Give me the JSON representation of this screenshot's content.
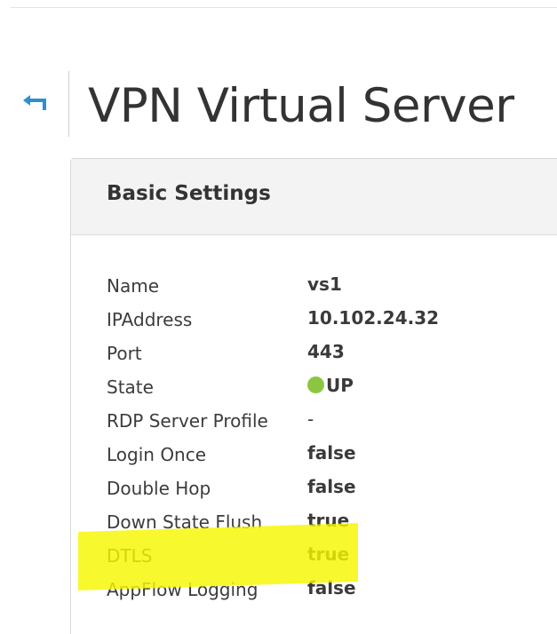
{
  "header": {
    "back_icon": "back-arrow-icon",
    "title": "VPN Virtual Server"
  },
  "panel": {
    "title": "Basic Settings",
    "rows": [
      {
        "label": "Name",
        "value": "vs1"
      },
      {
        "label": "IPAddress",
        "value": "10.102.24.32"
      },
      {
        "label": "Port",
        "value": "443"
      },
      {
        "label": "State",
        "value": "UP",
        "status_color": "#8cc640"
      },
      {
        "label": "RDP Server Profile",
        "value": "-"
      },
      {
        "label": "Login Once",
        "value": "false"
      },
      {
        "label": "Double Hop",
        "value": "false"
      },
      {
        "label": "Down State Flush",
        "value": "true"
      },
      {
        "label": "DTLS",
        "value": "true"
      },
      {
        "label": "AppFlow Logging",
        "value": "false"
      }
    ]
  },
  "colors": {
    "accent": "#2f8ed3",
    "highlight": "#f7f700"
  }
}
